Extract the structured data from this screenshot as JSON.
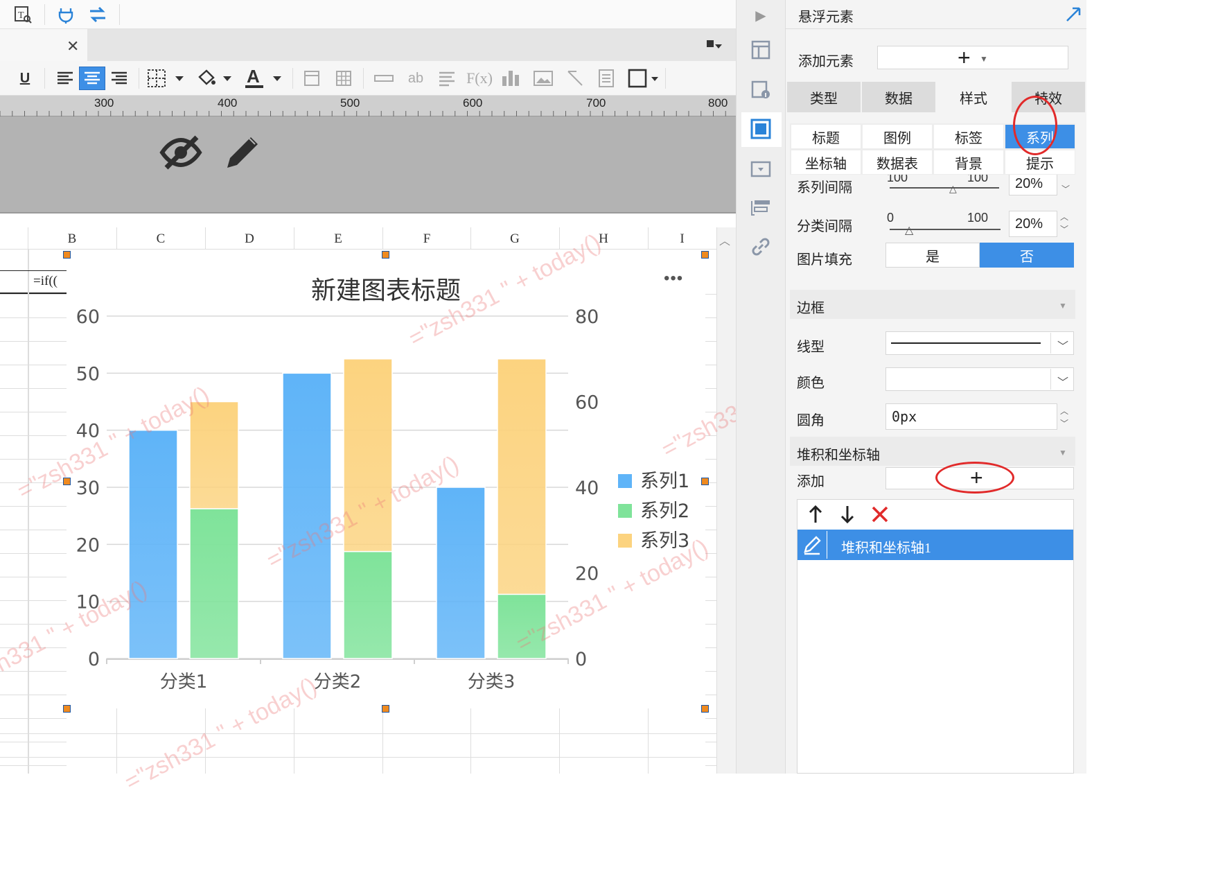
{
  "toolbar": {
    "underline": "U",
    "text_label": "ab",
    "formula_label": "F(x)",
    "font_color_glyph": "A"
  },
  "ruler": {
    "labels": [
      "300",
      "400",
      "500",
      "600",
      "700",
      "800"
    ]
  },
  "columns": [
    "B",
    "C",
    "D",
    "E",
    "F",
    "G",
    "H",
    "I"
  ],
  "cells": {
    "formula": "=if(("
  },
  "chart_data": {
    "type": "bar",
    "title": "新建图表标题",
    "categories": [
      "分类1",
      "分类2",
      "分类3"
    ],
    "series": [
      {
        "name": "系列1",
        "axis": "left",
        "stack": "a",
        "values": [
          40,
          50,
          30
        ],
        "color": "#5fb4f8"
      },
      {
        "name": "系列2",
        "axis": "right",
        "stack": "b",
        "values": [
          35,
          25,
          15
        ],
        "color": "#7fe39a"
      },
      {
        "name": "系列3",
        "axis": "right",
        "stack": "b",
        "values": [
          25,
          45,
          55
        ],
        "color": "#fcd37f"
      }
    ],
    "y_left": {
      "ticks": [
        "0",
        "10",
        "20",
        "30",
        "40",
        "50",
        "60"
      ],
      "range": [
        0,
        60
      ]
    },
    "y_right": {
      "ticks": [
        "0",
        "20",
        "40",
        "60",
        "80"
      ],
      "range": [
        0,
        80
      ]
    },
    "legend": "right",
    "grid": true
  },
  "chart_menu": "•••",
  "watermark": "=\"zsh331 \" + today()",
  "panel": {
    "title": "悬浮元素",
    "add_element_label": "添加元素",
    "add_button": "+",
    "main_tabs": [
      "类型",
      "数据",
      "样式",
      "特效"
    ],
    "sub_tabs_row1": [
      "标题",
      "图例",
      "标签",
      "系列"
    ],
    "sub_tabs_row2": [
      "坐标轴",
      "数据表",
      "背景",
      "提示"
    ],
    "series_gap": {
      "label": "系列间隔",
      "min": "100",
      "max": "100",
      "value": "20%"
    },
    "category_gap": {
      "label": "分类间隔",
      "min": "0",
      "max": "100",
      "value": "20%"
    },
    "image_fill": {
      "label": "图片填充",
      "yes": "是",
      "no": "否"
    },
    "border_section": "边框",
    "line_type_label": "线型",
    "color_label": "颜色",
    "radius_label": "圆角",
    "radius_value": "0px",
    "stack_section": "堆积和坐标轴",
    "add_label": "添加",
    "stack_item": "堆积和坐标轴1"
  }
}
